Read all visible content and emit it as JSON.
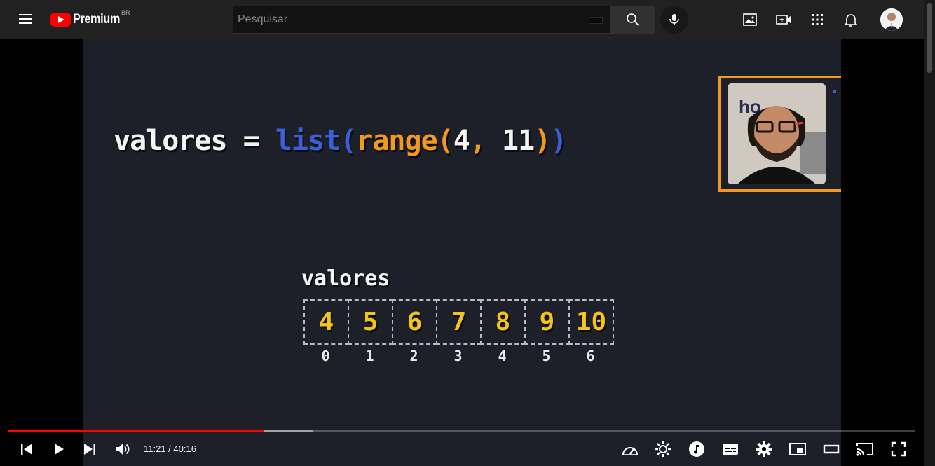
{
  "header": {
    "brand": "Premium",
    "country": "BR",
    "search_placeholder": "Pesquisar"
  },
  "icons": {
    "menu": "hamburger-menu-icon",
    "search": "search-icon",
    "mic": "microphone-icon",
    "create_post": "image-icon",
    "create_video": "video-plus-icon",
    "apps": "apps-grid-icon",
    "notifications": "bell-icon",
    "account": "avatar"
  },
  "video": {
    "code_parts": [
      {
        "text": "valores ",
        "color": "white"
      },
      {
        "text": "= ",
        "color": "white"
      },
      {
        "text": "list(",
        "color": "blue"
      },
      {
        "text": "range(",
        "color": "orange"
      },
      {
        "text": "4",
        "color": "white"
      },
      {
        "text": ", ",
        "color": "orange"
      },
      {
        "text": "11",
        "color": "white"
      },
      {
        "text": ")",
        "color": "orange"
      },
      {
        "text": ")",
        "color": "blue"
      }
    ],
    "array_label": "valores",
    "values": [
      "4",
      "5",
      "6",
      "7",
      "8",
      "9",
      "10"
    ],
    "indices": [
      "0",
      "1",
      "2",
      "3",
      "4",
      "5",
      "6"
    ],
    "webcam_text": "ho"
  },
  "player": {
    "current_time": "11:21",
    "duration": "40:16",
    "time_display": "11:21 / 40:16",
    "played_fraction": 0.282,
    "loaded_fraction": 0.336
  },
  "colors": {
    "accent": "#ff0000",
    "code_blue": "#3b5fd6",
    "code_orange": "#f19a1f",
    "cell_yellow": "#f4c418"
  }
}
